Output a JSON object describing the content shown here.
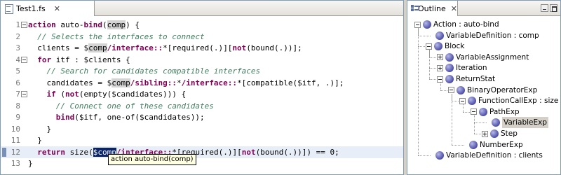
{
  "editor": {
    "tab_label": "Test1.fs",
    "close_glyph": "✕",
    "lines": [
      {
        "no": "1",
        "fold": true,
        "parts": [
          [
            "kw",
            "action"
          ],
          [
            "n",
            " auto-"
          ],
          [
            "kw",
            "bind"
          ],
          [
            "n",
            "("
          ],
          [
            "hl",
            "comp"
          ],
          [
            "n",
            ") {"
          ]
        ]
      },
      {
        "no": "2",
        "parts": [
          [
            "n",
            "  "
          ],
          [
            "cm",
            "// Selects the interfaces to connect"
          ]
        ]
      },
      {
        "no": "3",
        "parts": [
          [
            "n",
            "  clients = $"
          ],
          [
            "hl",
            "comp"
          ],
          [
            "kw",
            "/interface::"
          ],
          [
            "n",
            "*["
          ],
          [
            "n",
            "required(.)"
          ],
          [
            "n",
            "]["
          ],
          [
            "kw",
            "not"
          ],
          [
            "n",
            "(bound(.))];"
          ]
        ]
      },
      {
        "no": "4",
        "fold": true,
        "parts": [
          [
            "n",
            "  "
          ],
          [
            "kw",
            "for"
          ],
          [
            "n",
            " itf : $clients {"
          ]
        ]
      },
      {
        "no": "5",
        "parts": [
          [
            "n",
            "    "
          ],
          [
            "cm",
            "// Search for candidates compatible interfaces"
          ]
        ]
      },
      {
        "no": "6",
        "parts": [
          [
            "n",
            "    candidates = $"
          ],
          [
            "hl",
            "comp"
          ],
          [
            "kw",
            "/sibling::"
          ],
          [
            "n",
            "*"
          ],
          [
            "kw",
            "/interface::"
          ],
          [
            "n",
            "*[compatible($itf, .)];"
          ]
        ]
      },
      {
        "no": "7",
        "fold": true,
        "parts": [
          [
            "n",
            "    "
          ],
          [
            "kw",
            "if"
          ],
          [
            "n",
            " ("
          ],
          [
            "kw",
            "not"
          ],
          [
            "n",
            "(empty($candidates))) {"
          ]
        ]
      },
      {
        "no": "8",
        "parts": [
          [
            "n",
            "      "
          ],
          [
            "cm",
            "// Connect one of these candidates"
          ]
        ]
      },
      {
        "no": "9",
        "parts": [
          [
            "n",
            "      "
          ],
          [
            "kw",
            "bind"
          ],
          [
            "n",
            "($itf, one-of($candidates));"
          ]
        ]
      },
      {
        "no": "10",
        "parts": [
          [
            "n",
            "    }"
          ]
        ]
      },
      {
        "no": "11",
        "parts": [
          [
            "n",
            "  }"
          ]
        ]
      },
      {
        "no": "12",
        "current": true,
        "marker": true,
        "parts": [
          [
            "n",
            "  "
          ],
          [
            "kw",
            "return"
          ],
          [
            "n",
            " size("
          ],
          [
            "sel",
            "$comp"
          ],
          [
            "kw",
            "/interface::"
          ],
          [
            "n",
            "*[required(.)]["
          ],
          [
            "kw",
            "not"
          ],
          [
            "n",
            "(bound(.))]) == 0;"
          ]
        ]
      },
      {
        "no": "13",
        "parts": [
          [
            "n",
            "}"
          ]
        ]
      }
    ],
    "tooltip": "action auto-bind(comp)"
  },
  "outline": {
    "tab_label": "Outline",
    "close_glyph": "✕",
    "nodes": [
      {
        "label": "Action : auto-bind",
        "indent": 0,
        "twisty": "minus"
      },
      {
        "label": "VariableDefinition : comp",
        "indent": 1,
        "twisty": "none"
      },
      {
        "label": "Block",
        "indent": 1,
        "twisty": "minus"
      },
      {
        "label": "VariableAssignment",
        "indent": 2,
        "twisty": "plus"
      },
      {
        "label": "Iteration",
        "indent": 2,
        "twisty": "plus"
      },
      {
        "label": "ReturnStat",
        "indent": 2,
        "twisty": "minus"
      },
      {
        "label": "BinaryOperatorExp",
        "indent": 3,
        "twisty": "minus"
      },
      {
        "label": "FunctionCallExp : size",
        "indent": 4,
        "twisty": "minus"
      },
      {
        "label": "PathExp",
        "indent": 5,
        "twisty": "minus"
      },
      {
        "label": "VariableExp",
        "indent": 6,
        "twisty": "none",
        "selected": true
      },
      {
        "label": "Step",
        "indent": 6,
        "twisty": "plus"
      },
      {
        "label": "NumberExp",
        "indent": 4,
        "twisty": "none"
      },
      {
        "label": "VariableDefinition : clients",
        "indent": 1,
        "twisty": "none"
      }
    ]
  }
}
